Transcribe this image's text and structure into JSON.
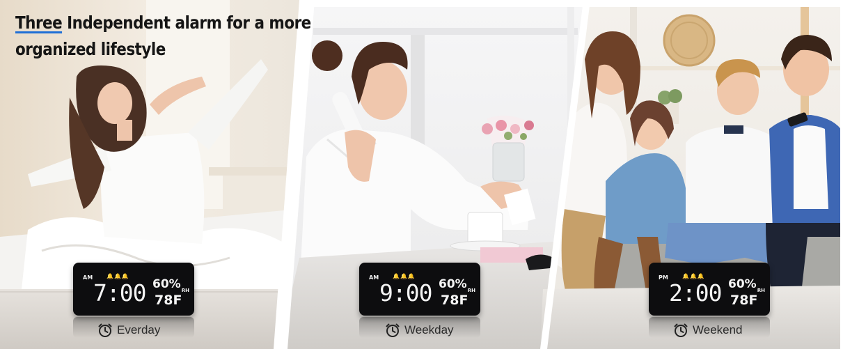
{
  "headline": {
    "accent_word": "Three",
    "line1_rest": "Independent alarm for a more",
    "line2": "organized lifestyle"
  },
  "panels": [
    {
      "scene_icon": "stretching-woman-photo-icon",
      "clock": {
        "period": "AM",
        "time": "7:00",
        "humidity": "60%",
        "humidity_unit": "RH",
        "temperature": "78F"
      },
      "label": "Everday"
    },
    {
      "scene_icon": "woman-on-phone-photo-icon",
      "clock": {
        "period": "AM",
        "time": "9:00",
        "humidity": "60%",
        "humidity_unit": "RH",
        "temperature": "78F"
      },
      "label": "Weekday"
    },
    {
      "scene_icon": "family-on-sofa-photo-icon",
      "clock": {
        "period": "PM",
        "time": "2:00",
        "humidity": "60%",
        "humidity_unit": "RH",
        "temperature": "78F"
      },
      "label": "Weekend"
    }
  ],
  "colors": {
    "accent_underline": "#1f6fd6",
    "clock_body": "#0d0d0f",
    "clock_digits": "#f4f4f4",
    "caption_text": "#2a2a2a"
  }
}
